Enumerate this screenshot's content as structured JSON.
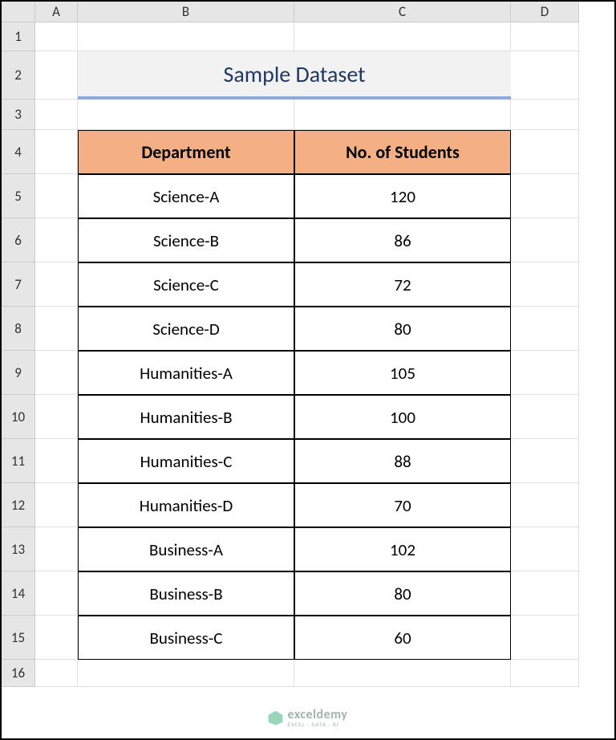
{
  "columns": [
    "A",
    "B",
    "C",
    "D"
  ],
  "rows": [
    "1",
    "2",
    "3",
    "4",
    "5",
    "6",
    "7",
    "8",
    "9",
    "10",
    "11",
    "12",
    "13",
    "14",
    "15",
    "16"
  ],
  "title": "Sample Dataset",
  "table": {
    "headers": [
      "Department",
      "No. of Students"
    ],
    "data": [
      {
        "dept": "Science-A",
        "n": "120"
      },
      {
        "dept": "Science-B",
        "n": "86"
      },
      {
        "dept": "Science-C",
        "n": "72"
      },
      {
        "dept": "Science-D",
        "n": "80"
      },
      {
        "dept": "Humanities-A",
        "n": "105"
      },
      {
        "dept": "Humanities-B",
        "n": "100"
      },
      {
        "dept": "Humanities-C",
        "n": "88"
      },
      {
        "dept": "Humanities-D",
        "n": "70"
      },
      {
        "dept": "Business-A",
        "n": "102"
      },
      {
        "dept": "Business-B",
        "n": "80"
      },
      {
        "dept": "Business-C",
        "n": "60"
      }
    ]
  },
  "watermark": {
    "brand": "exceldemy",
    "tagline": "EXCEL · DATA · BI"
  }
}
